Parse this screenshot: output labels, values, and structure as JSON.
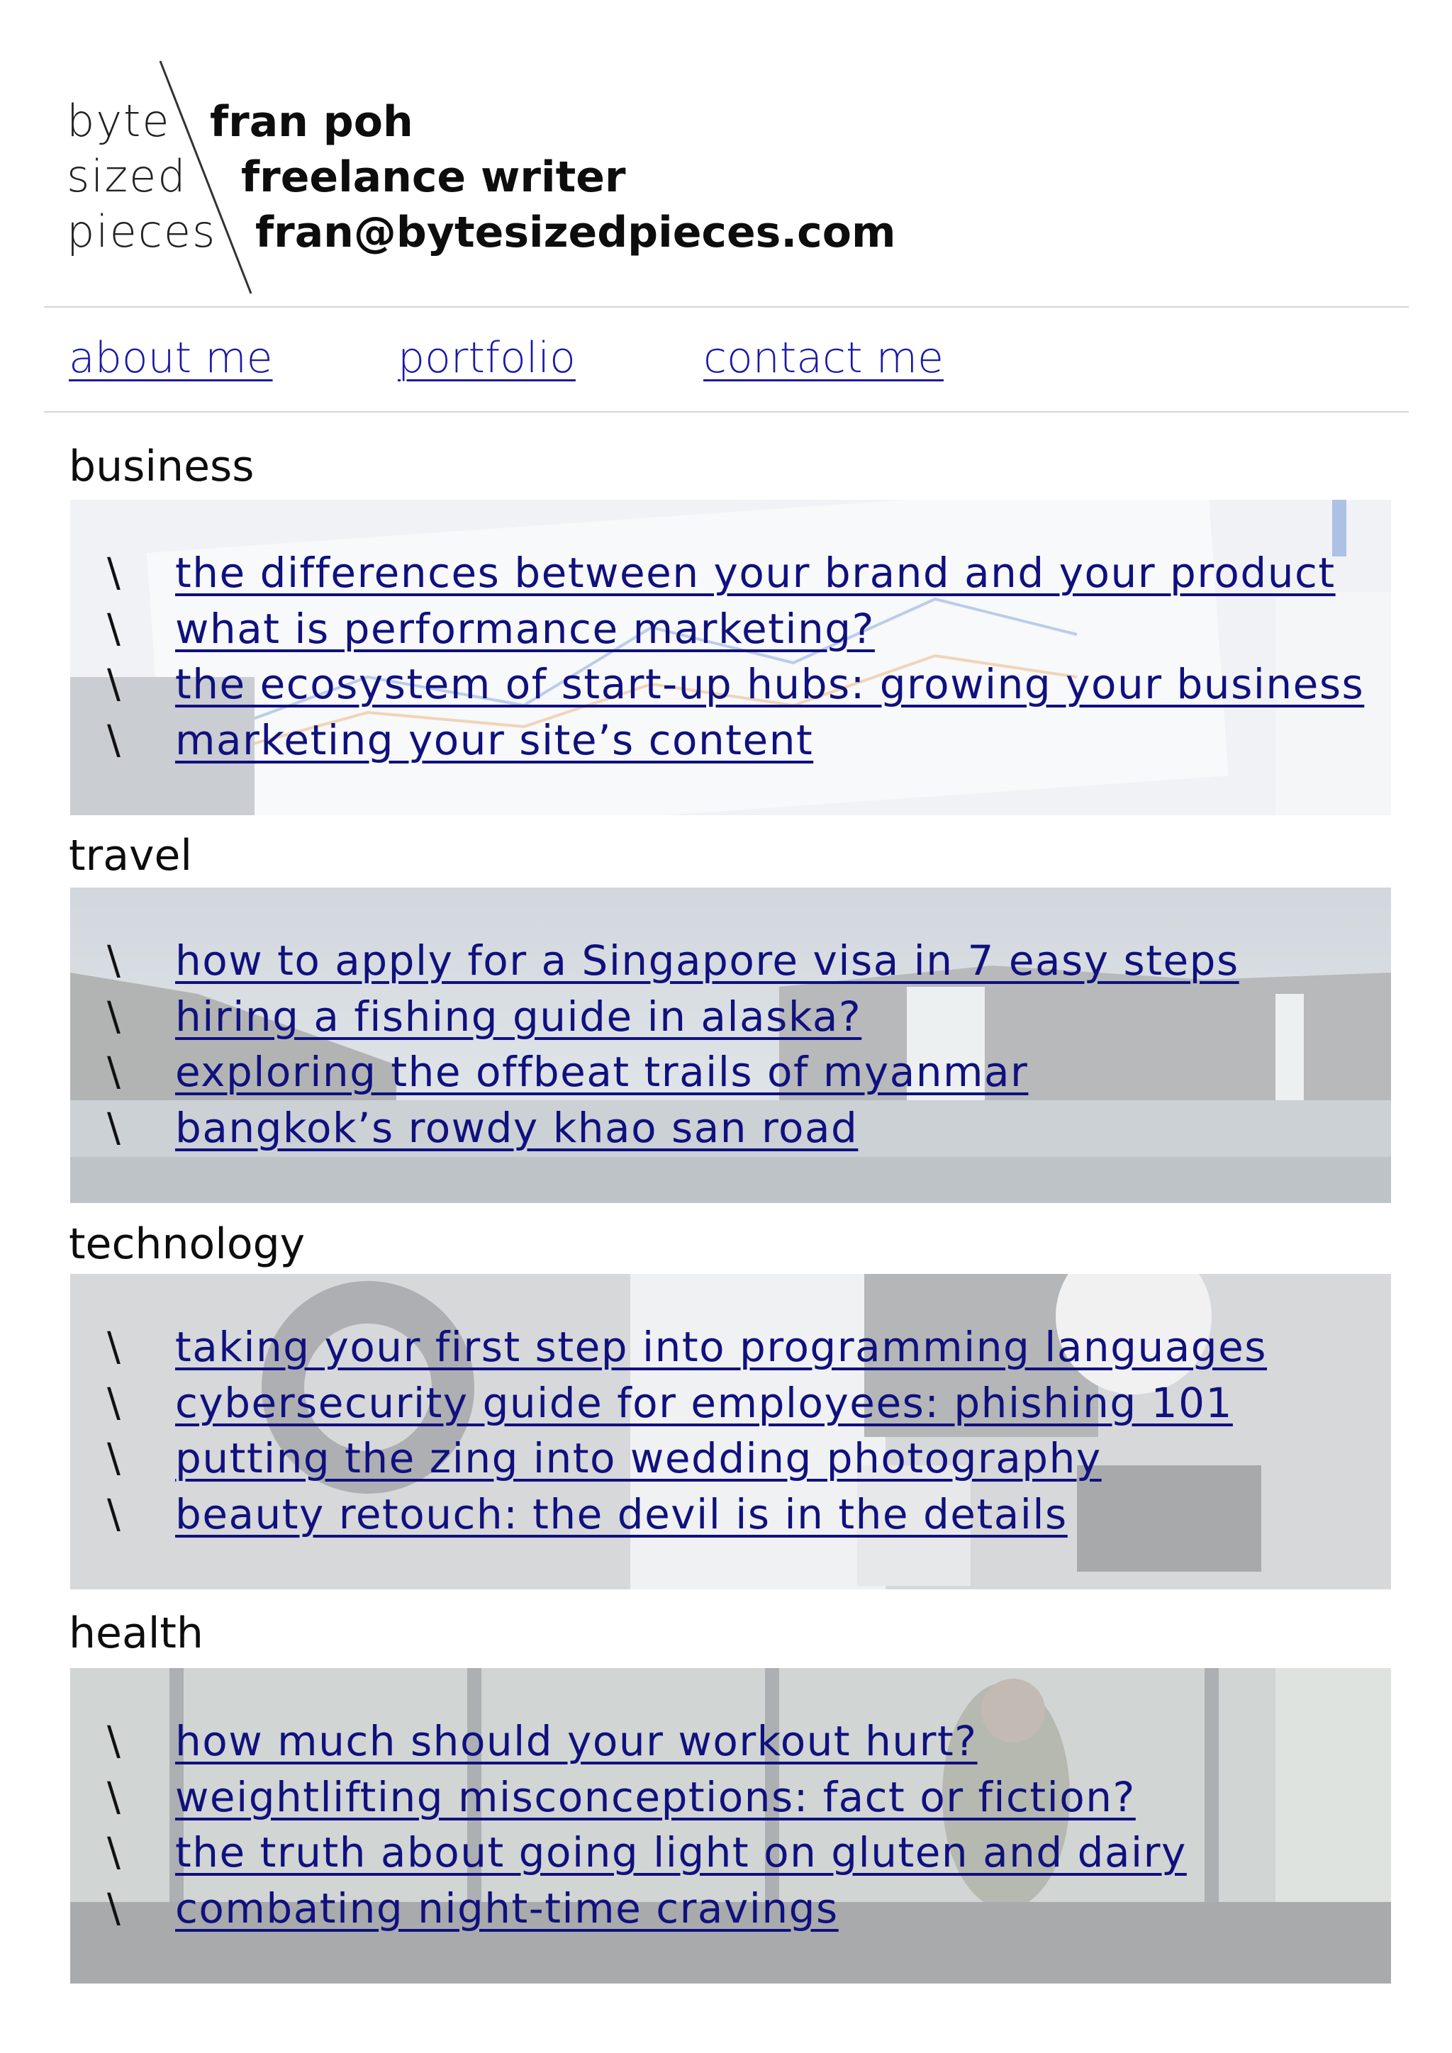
{
  "logo": {
    "line1": "byte",
    "line2": "sized",
    "line3": "pieces"
  },
  "identity": {
    "name": "fran poh",
    "role": "freelance writer",
    "email": "fran@bytesizedpieces.com"
  },
  "nav": {
    "about": "about me",
    "portfolio": "portfolio",
    "contact": "contact me"
  },
  "bullet_glyph": "\\",
  "colors": {
    "link": "#10107e",
    "nav_link": "#1a1aa6",
    "text": "#0d0d0d",
    "rule": "#d6d6d6"
  },
  "sections": [
    {
      "title": "business",
      "image": "analytics-dashboard-printout",
      "links": [
        "the differences between your brand and your product",
        "what is performance marketing?",
        "the ecosystem of start-up hubs: growing your business",
        "marketing your site’s content"
      ]
    },
    {
      "title": "travel",
      "image": "waterfall-seascape",
      "links": [
        "how to apply for a Singapore visa in 7 easy steps",
        "hiring a fishing guide in alaska?",
        "exploring the offbeat trails of myanmar",
        "bangkok’s rowdy khao san road"
      ]
    },
    {
      "title": "technology",
      "image": "desk-with-keyboard-headphones-stickers",
      "links": [
        "taking your first step into programming languages",
        "cybersecurity guide for employees: phishing 101",
        "putting the zing into wedding photography",
        "beauty retouch: the devil is in the details"
      ]
    },
    {
      "title": "health",
      "image": "gym-treadmill-runner",
      "links": [
        "how much should your workout hurt?",
        "weightlifting misconceptions: fact or fiction?",
        "the truth about going light on gluten and dairy",
        "combating night-time cravings"
      ]
    }
  ]
}
